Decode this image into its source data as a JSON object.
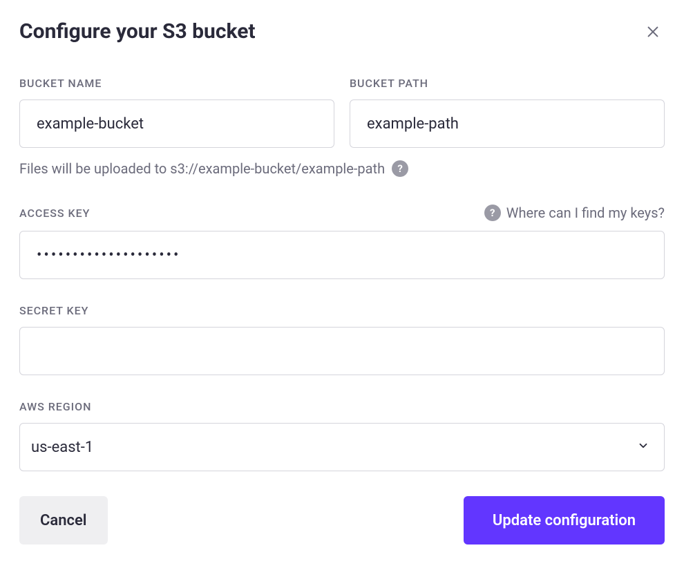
{
  "dialog": {
    "title": "Configure your S3 bucket"
  },
  "fields": {
    "bucket_name": {
      "label": "BUCKET NAME",
      "value": "example-bucket"
    },
    "bucket_path": {
      "label": "BUCKET PATH",
      "value": "example-path"
    },
    "upload_hint": "Files will be uploaded to s3://example-bucket/example-path",
    "access_key": {
      "label": "ACCESS KEY",
      "value": "••••••••••••••••••••",
      "help_text": "Where can I find my keys?"
    },
    "secret_key": {
      "label": "SECRET KEY",
      "value": ""
    },
    "aws_region": {
      "label": "AWS REGION",
      "value": "us-east-1"
    }
  },
  "buttons": {
    "cancel": "Cancel",
    "submit": "Update configuration"
  }
}
